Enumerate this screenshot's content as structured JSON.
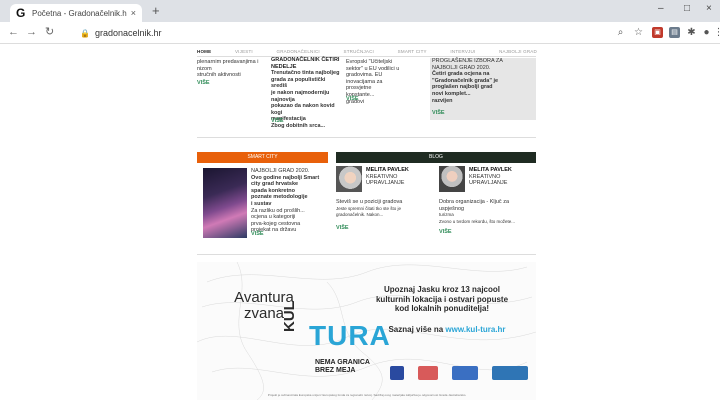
{
  "browser": {
    "tab_title": "Početna - Gradonačelnik.hr",
    "tab_close": "×",
    "new_tab": "+",
    "url": "gradonacelnik.hr",
    "window": {
      "minimize": "–",
      "maximize": "□",
      "close": "×"
    }
  },
  "site": {
    "nav": [
      {
        "label": "HOME",
        "active": true
      },
      {
        "label": "VIJESTI",
        "active": false
      },
      {
        "label": "GRADONAČELNICI",
        "active": false
      },
      {
        "label": "STRUČNJACI",
        "active": false
      },
      {
        "label": "SMART CITY",
        "active": false
      },
      {
        "label": "INTERVJUI",
        "active": false
      },
      {
        "label": "NAJBOLJI GRAD",
        "active": false
      }
    ],
    "top_articles": [
      {
        "lines": [
          "plenarnim predavanjima i nizom",
          "stručnih aktivnosti"
        ],
        "more": "VIŠE"
      },
      {
        "heading": "GRADONAČELNIK ČETIRI NEDELJE",
        "lines": [
          "Trenutačno tinta najboljeg",
          "grada za populistički središ",
          "je nakon najmoderniju najnovija",
          "pokazao da nakon kovid",
          "kogi",
          "manifestacija",
          "Zbog dobitnih srca..."
        ],
        "more": "VIŠE"
      },
      {
        "lines": [
          "Evropski \"Učiteljski",
          "sektor\" u EU vodilici u",
          "gradovima. EU",
          "inovacijama za",
          "prosvjetne",
          "konstante...",
          "gradovi"
        ],
        "more": "VIŠE"
      },
      {
        "lines": [
          "PROGLAŠENJE IZBORA ZA",
          "NAJBOLJI GRAD 2020.",
          "Četiri grada ocjena na",
          "\"Gradonačelnik grada\" je",
          "proglašen najbolji grad",
          "novi komplet...",
          "razvijen"
        ],
        "more": "VIŠE"
      }
    ],
    "smart_city": {
      "band": "SMART CITY",
      "heading": "NAJBOLJI GRAD 2020.",
      "lines": [
        "Ovo godine najbolji Smart",
        "city grad hrvatske",
        "spada konkretno",
        "poznate metodologije",
        "i sustav",
        "Za razliku od prošlih...",
        "ocjena u kategoriji",
        "prva-kojeg cestovna",
        "projekat na državu",
        "Smart city..."
      ],
      "more": "VIŠE"
    },
    "blog": {
      "band": "BLOG",
      "entries": [
        {
          "name": "MELITA PAVLEK",
          "role": [
            "KREATIVNO",
            "UPRAVLJANJE"
          ],
          "title": "Steviš se u poziciji gradova",
          "excerpt": [
            "Jeste spremni čitati tko ste što je",
            "gradonačelnik. Nakon..."
          ],
          "more": "VIŠE"
        },
        {
          "name": "MELITA PAVLEK",
          "role": [
            "KREATIVNO",
            "UPRAVLJANJE"
          ],
          "title": "Dobra organizacija - Ključ za uspješnog",
          "excerpt": [
            "turizma",
            "Zvono u tvrdom rekordu, što možete..."
          ],
          "more": "VIŠE"
        }
      ]
    },
    "banner": {
      "avantura": "Avantura zvana",
      "kul": "KUL",
      "tura": "TURA",
      "nema": [
        "NEMA GRANICA",
        "BREZ MEJA"
      ],
      "upoznaj": "Upoznaj Jasku kroz 13 najcool kulturnih lokacija i ostvari popuste kod lokalnih ponuditelja!",
      "saznaj": "Saznaj više na",
      "link": "www.kul-tura.hr",
      "fine": "Projekt je sufinancirala Europska unija iz Europskog fonda za regionalni razvoj. Sadržaj ovog materijala isključiva je odgovornost Grada Jastrebarsko."
    }
  },
  "colors": {
    "accent_orange": "#e8600a",
    "accent_dark": "#1f2b22",
    "link_green": "#2e8b57",
    "banner_blue": "#2aa5d6"
  }
}
